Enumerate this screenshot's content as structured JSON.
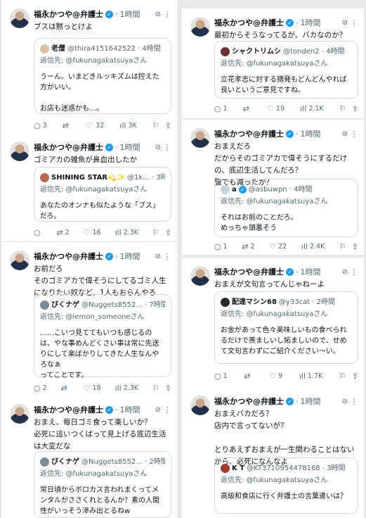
{
  "author": {
    "name": "福永かつや@弁護士",
    "verified_mark": "✓",
    "time": "1時間",
    "grok_icon": "grok-icon",
    "more_glyph": "⋮"
  },
  "icons": {
    "reply": "○",
    "retweet": "⇄",
    "like": "♡",
    "views": "ıll",
    "bookmark": "⚐",
    "share": "⇪"
  },
  "left": [
    {
      "text": "ブスは黙っとけよ",
      "quote": {
        "avatar_color": "#d9c3a5",
        "name": "老僧",
        "meta": "@thira4151642522 · 4時間",
        "reply_to": "返信先: @fukunagakatsuyaさん",
        "text": "うーん。いまどきルッキズムは控えた方がいい。\n\nお店も迷惑かも…。"
      },
      "stats": {
        "replies": "3",
        "retweets": "",
        "likes": "32",
        "views": "3K"
      }
    },
    {
      "text": "ゴミアカの雑魚が鼻血出したか",
      "quote": {
        "avatar_color": "#b86a4f",
        "name": "SHINING STAR💫✨",
        "meta": "@1k... · 3時間",
        "reply_to": "返信先: @fukunagakatsuyaさん",
        "text": "あなたのオンナも似たような「ブス」だろ。"
      },
      "stats": {
        "replies": "",
        "retweets": "2",
        "likes": "16",
        "views": "2.3K"
      }
    },
    {
      "text": "お前だろ\nそのゴミアカで偉そうにしてるゴミ人生になりたい奴など、1人もおらんやろ",
      "quote": {
        "avatar_color": "#7c8a99",
        "name": "びくナゲ",
        "meta": "@Nuggets8552... · 7時間",
        "reply_to": "返信先: @lemon_someoneさん",
        "text": "……こいつ見ててもいつも感じるのは、やな事めんどくさい事は常に先送りにして楽ばかりしてきた人生なんやろなぁ\nってことです。"
      },
      "stats": {
        "replies": "2",
        "retweets": "",
        "likes": "18",
        "views": "2.3K"
      }
    },
    {
      "text": "おまえ、毎日ゴミ食って楽しいか？\n必死に這いつくばって見上げる底辺生活は大変だな",
      "quote": {
        "avatar_color": "#7c8a99",
        "name": "びくナゲ",
        "meta": "@Nuggets8552... · 2時間",
        "reply_to": "返信先: @fukunagakatsuyaさん",
        "text": "常日頃からボロカス言われまくってメンタルがささくれとるんか？素の人間性がいっそう滲み出とるねw"
      },
      "stats": null
    }
  ],
  "right": [
    {
      "text": "最初からそうなってるが、バカなのか？",
      "quote": {
        "avatar_color": "#6b2f3a",
        "name": "シャクトリムシ",
        "meta": "@tonden2 · 4時間",
        "reply_to": "返信先: @fukunagakatsuyaさん",
        "text": "立花孝志に対する摘発もどんどんやれば良いというご意見ですね。"
      },
      "stats": {
        "replies": "1",
        "retweets": "",
        "likes": "19",
        "views": "2.1K"
      }
    },
    {
      "text": "おまえだろ\nだからそのゴミアカで偉そうにするだけの、底辺生活してんだろ？\n腹でも減ったか？",
      "quote": {
        "avatar_color": "#c9d3dc",
        "name": "a",
        "verified": true,
        "meta": "@asbuwpn · 4時間",
        "reply_to": "返信先: @fukunagakatsuyaさん",
        "text": "それはお前のことだろ。\nめっちゃ頭悪そう"
      },
      "stats": {
        "replies": "1",
        "retweets": "2",
        "likes": "22",
        "views": "2.4K"
      }
    },
    {
      "text": "おまえが文句言ってんじゃねーよ",
      "quote": {
        "avatar_color": "#2a2a2a",
        "name": "配達マシン68",
        "meta": "@y33cat · 2時間",
        "reply_to": "返信先: @fukunagakatsuyaさん",
        "text": "お金があって色々美味しいもの食べられるだけで羨ましいし妬ましいので、せめて文句言わずにご紹介ください〜い。"
      },
      "stats": {
        "replies": "1",
        "retweets": "",
        "likes": "9",
        "views": "1.7K"
      }
    },
    {
      "text": "おまえバカだろ？\n店内で言ってないが？\n\nとりあえずおまえが一生関わることはないから、必死になんなよ",
      "quote": {
        "avatar_color": "#a33a2e",
        "name": "K T",
        "meta": "@KT3710954478168 · 3時間",
        "reply_to": "返信先: @fukunagakatsuyaさん",
        "text": "高級和食店に行く弁護士の言葉遣いは？"
      },
      "stats": null
    }
  ]
}
